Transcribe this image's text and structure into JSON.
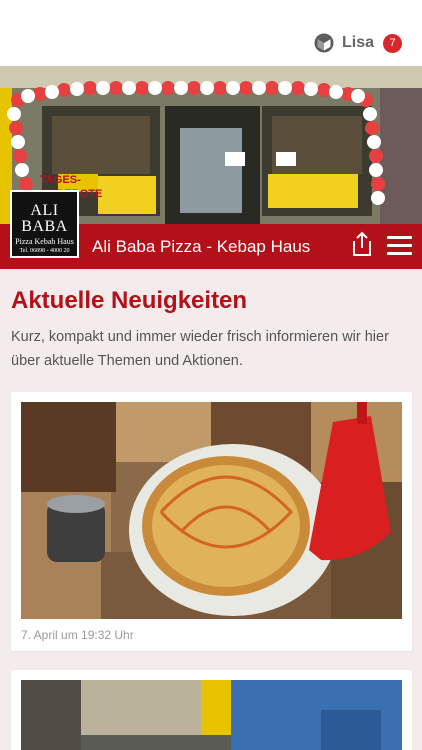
{
  "header": {
    "user_name": "Lisa",
    "notification_count": "7"
  },
  "shop": {
    "logo_line1": "ALI BABA",
    "logo_line2": "Pizza Kebab Haus",
    "logo_line3": "Tel. 06898 - 4000 20",
    "name": "Ali Baba Pizza - Kebap Haus"
  },
  "hero_signs": {
    "tages": "TAGES-",
    "angebote": "ANGEBOTE"
  },
  "news": {
    "title": "Aktuelle Neuigkeiten",
    "intro": "Kurz, kompakt und immer wieder frisch informieren wir hier über aktuelle Themen und Aktionen.",
    "posts": [
      {
        "date": "7. April um 19:32 Uhr"
      }
    ]
  },
  "colors": {
    "brand_red": "#b3101a",
    "badge_red": "#d9262c",
    "page_bg": "#f4ecec"
  },
  "icons": [
    "cube-logo-icon",
    "share-icon",
    "menu-icon"
  ]
}
